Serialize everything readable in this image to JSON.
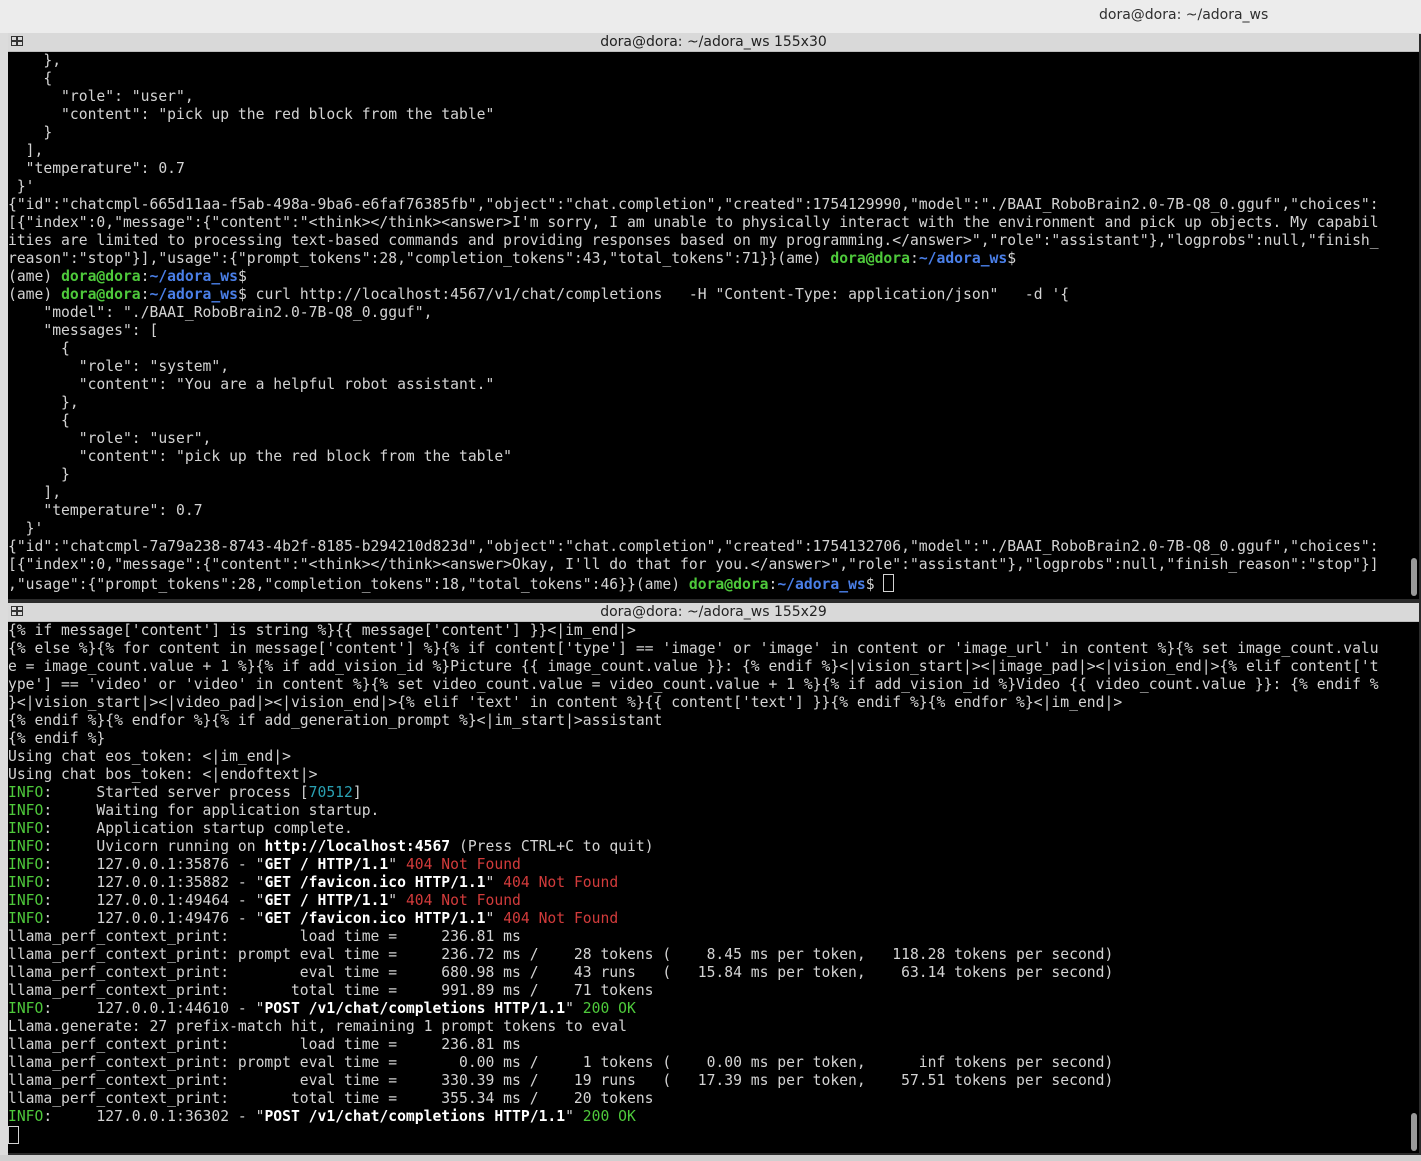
{
  "window": {
    "title": "dora@dora: ~/adora_ws"
  },
  "pane_top": {
    "title": "dora@dora: ~/adora_ws 155x30",
    "lines": [
      [
        [
          "t",
          "    },"
        ]
      ],
      [
        [
          "t",
          "    {"
        ]
      ],
      [
        [
          "t",
          "      \"role\": \"user\","
        ]
      ],
      [
        [
          "t",
          "      \"content\": \"pick up the red block from the table\""
        ]
      ],
      [
        [
          "t",
          "    }"
        ]
      ],
      [
        [
          "t",
          "  ],"
        ]
      ],
      [
        [
          "t",
          "  \"temperature\": 0.7"
        ]
      ],
      [
        [
          "t",
          " }'"
        ]
      ],
      [
        [
          "t",
          "{\"id\":\"chatcmpl-665d11aa-f5ab-498a-9ba6-e6faf76385fb\",\"object\":\"chat.completion\",\"created\":1754129990,\"model\":\"./BAAI_RoboBrain2.0-7B-Q8_0.gguf\",\"choices\":"
        ]
      ],
      [
        [
          "t",
          "[{\"index\":0,\"message\":{\"content\":\"<think></think><answer>I'm sorry, I am unable to physically interact with the environment and pick up objects. My capabil"
        ]
      ],
      [
        [
          "t",
          "ities are limited to processing text-based commands and providing responses based on my programming.</answer>\",\"role\":\"assistant\"},\"logprobs\":null,\"finish_"
        ]
      ],
      [
        [
          "t",
          "reason\":\"stop\"}],\"usage\":{\"prompt_tokens\":28,\"completion_tokens\":43,\"total_tokens\":71}}(ame) "
        ],
        [
          "g",
          "dora@dora"
        ],
        [
          "t",
          ":"
        ],
        [
          "b",
          "~/adora_ws"
        ],
        [
          "t",
          "$"
        ]
      ],
      [
        [
          "t",
          "(ame) "
        ],
        [
          "g",
          "dora@dora"
        ],
        [
          "t",
          ":"
        ],
        [
          "b",
          "~/adora_ws"
        ],
        [
          "t",
          "$"
        ]
      ],
      [
        [
          "t",
          "(ame) "
        ],
        [
          "g",
          "dora@dora"
        ],
        [
          "t",
          ":"
        ],
        [
          "b",
          "~/adora_ws"
        ],
        [
          "t",
          "$ curl http://localhost:4567/v1/chat/completions   -H \"Content-Type: application/json\"   -d '{"
        ]
      ],
      [
        [
          "t",
          "    \"model\": \"./BAAI_RoboBrain2.0-7B-Q8_0.gguf\","
        ]
      ],
      [
        [
          "t",
          "    \"messages\": ["
        ]
      ],
      [
        [
          "t",
          "      {"
        ]
      ],
      [
        [
          "t",
          "        \"role\": \"system\","
        ]
      ],
      [
        [
          "t",
          "        \"content\": \"You are a helpful robot assistant.\""
        ]
      ],
      [
        [
          "t",
          "      },"
        ]
      ],
      [
        [
          "t",
          "      {"
        ]
      ],
      [
        [
          "t",
          "        \"role\": \"user\","
        ]
      ],
      [
        [
          "t",
          "        \"content\": \"pick up the red block from the table\""
        ]
      ],
      [
        [
          "t",
          "      }"
        ]
      ],
      [
        [
          "t",
          "    ],"
        ]
      ],
      [
        [
          "t",
          "    \"temperature\": 0.7"
        ]
      ],
      [
        [
          "t",
          "  }'"
        ]
      ],
      [
        [
          "t",
          "{\"id\":\"chatcmpl-7a79a238-8743-4b2f-8185-b294210d823d\",\"object\":\"chat.completion\",\"created\":1754132706,\"model\":\"./BAAI_RoboBrain2.0-7B-Q8_0.gguf\",\"choices\":"
        ]
      ],
      [
        [
          "t",
          "[{\"index\":0,\"message\":{\"content\":\"<think></think><answer>Okay, I'll do that for you.</answer>\",\"role\":\"assistant\"},\"logprobs\":null,\"finish_reason\":\"stop\"}]"
        ]
      ],
      [
        [
          "t",
          ",\"usage\":{\"prompt_tokens\":28,\"completion_tokens\":18,\"total_tokens\":46}}(ame) "
        ],
        [
          "g",
          "dora@dora"
        ],
        [
          "t",
          ":"
        ],
        [
          "b",
          "~/adora_ws"
        ],
        [
          "t",
          "$ "
        ],
        [
          "cursor",
          ""
        ]
      ]
    ]
  },
  "pane_bottom": {
    "title": "dora@dora: ~/adora_ws 155x29",
    "lines": [
      [
        [
          "t",
          "{% if message['content'] is string %}{{ message['content'] }}<|im_end|>"
        ]
      ],
      [
        [
          "t",
          "{% else %}{% for content in message['content'] %}{% if content['type'] == 'image' or 'image' in content or 'image_url' in content %}{% set image_count.valu"
        ]
      ],
      [
        [
          "t",
          "e = image_count.value + 1 %}{% if add_vision_id %}Picture {{ image_count.value }}: {% endif %}<|vision_start|><|image_pad|><|vision_end|>{% elif content['t"
        ]
      ],
      [
        [
          "t",
          "ype'] == 'video' or 'video' in content %}{% set video_count.value = video_count.value + 1 %}{% if add_vision_id %}Video {{ video_count.value }}: {% endif %"
        ]
      ],
      [
        [
          "t",
          "}<|vision_start|><|video_pad|><|vision_end|>{% elif 'text' in content %}{{ content['text'] }}{% endif %}{% endfor %}<|im_end|>"
        ]
      ],
      [
        [
          "t",
          "{% endif %}{% endfor %}{% if add_generation_prompt %}<|im_start|>assistant"
        ]
      ],
      [
        [
          "t",
          "{% endif %}"
        ]
      ],
      [
        [
          "t",
          "Using chat eos_token: <|im_end|>"
        ]
      ],
      [
        [
          "t",
          "Using chat bos_token: <|endoftext|>"
        ]
      ],
      [
        [
          "inf",
          "INFO"
        ],
        [
          "t",
          ":     Started server process ["
        ],
        [
          "cy",
          "70512"
        ],
        [
          "t",
          "]"
        ]
      ],
      [
        [
          "inf",
          "INFO"
        ],
        [
          "t",
          ":     Waiting for application startup."
        ]
      ],
      [
        [
          "inf",
          "INFO"
        ],
        [
          "t",
          ":     Application startup complete."
        ]
      ],
      [
        [
          "inf",
          "INFO"
        ],
        [
          "t",
          ":     Uvicorn running on "
        ],
        [
          "w",
          "http://localhost:4567"
        ],
        [
          "t",
          " (Press CTRL+C to quit)"
        ]
      ],
      [
        [
          "inf",
          "INFO"
        ],
        [
          "t",
          ":     127.0.0.1:35876 - \""
        ],
        [
          "w",
          "GET / HTTP/1.1"
        ],
        [
          "t",
          "\" "
        ],
        [
          "r",
          "404 Not Found"
        ]
      ],
      [
        [
          "inf",
          "INFO"
        ],
        [
          "t",
          ":     127.0.0.1:35882 - \""
        ],
        [
          "w",
          "GET /favicon.ico HTTP/1.1"
        ],
        [
          "t",
          "\" "
        ],
        [
          "r",
          "404 Not Found"
        ]
      ],
      [
        [
          "inf",
          "INFO"
        ],
        [
          "t",
          ":     127.0.0.1:49464 - \""
        ],
        [
          "w",
          "GET / HTTP/1.1"
        ],
        [
          "t",
          "\" "
        ],
        [
          "r",
          "404 Not Found"
        ]
      ],
      [
        [
          "inf",
          "INFO"
        ],
        [
          "t",
          ":     127.0.0.1:49476 - \""
        ],
        [
          "w",
          "GET /favicon.ico HTTP/1.1"
        ],
        [
          "t",
          "\" "
        ],
        [
          "r",
          "404 Not Found"
        ]
      ],
      [
        [
          "t",
          "llama_perf_context_print:        load time =     236.81 ms"
        ]
      ],
      [
        [
          "t",
          "llama_perf_context_print: prompt eval time =     236.72 ms /    28 tokens (    8.45 ms per token,   118.28 tokens per second)"
        ]
      ],
      [
        [
          "t",
          "llama_perf_context_print:        eval time =     680.98 ms /    43 runs   (   15.84 ms per token,    63.14 tokens per second)"
        ]
      ],
      [
        [
          "t",
          "llama_perf_context_print:       total time =     991.89 ms /    71 tokens"
        ]
      ],
      [
        [
          "inf",
          "INFO"
        ],
        [
          "t",
          ":     127.0.0.1:44610 - \""
        ],
        [
          "w",
          "POST /v1/chat/completions HTTP/1.1"
        ],
        [
          "t",
          "\" "
        ],
        [
          "gr",
          "200 OK"
        ]
      ],
      [
        [
          "t",
          "Llama.generate: 27 prefix-match hit, remaining 1 prompt tokens to eval"
        ]
      ],
      [
        [
          "t",
          "llama_perf_context_print:        load time =     236.81 ms"
        ]
      ],
      [
        [
          "t",
          "llama_perf_context_print: prompt eval time =       0.00 ms /     1 tokens (    0.00 ms per token,      inf tokens per second)"
        ]
      ],
      [
        [
          "t",
          "llama_perf_context_print:        eval time =     330.39 ms /    19 runs   (   17.39 ms per token,    57.51 tokens per second)"
        ]
      ],
      [
        [
          "t",
          "llama_perf_context_print:       total time =     355.34 ms /    20 tokens"
        ]
      ],
      [
        [
          "inf",
          "INFO"
        ],
        [
          "t",
          ":     127.0.0.1:36302 - \""
        ],
        [
          "w",
          "POST /v1/chat/completions HTTP/1.1"
        ],
        [
          "t",
          "\" "
        ],
        [
          "gr",
          "200 OK"
        ]
      ],
      [
        [
          "cursor",
          ""
        ]
      ]
    ]
  }
}
